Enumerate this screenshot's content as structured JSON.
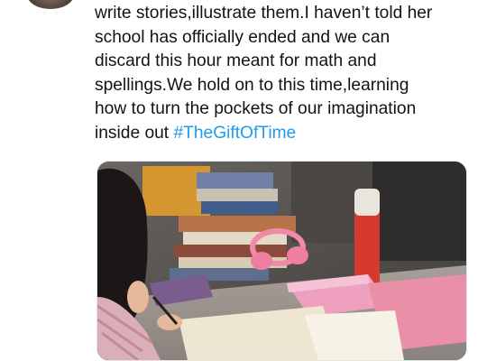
{
  "tweet": {
    "text": "write stories,illustrate them.I haven’t told her\nschool has officially ended and we can\ndiscard this hour meant for math and\nspellings.We hold on to this time,learning\nhow to turn the pockets of our imagination\ninside out ",
    "hashtag": "#TheGiftOfTime"
  },
  "colors": {
    "text": "#0f1419",
    "link": "#1d9bf0"
  },
  "icons": [
    "avatar"
  ]
}
